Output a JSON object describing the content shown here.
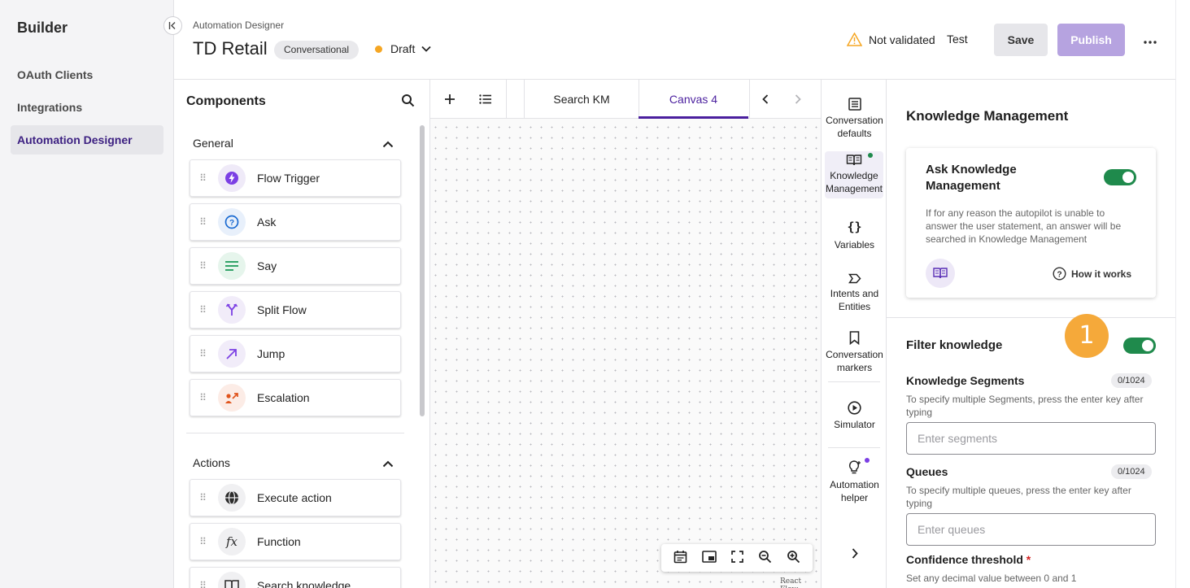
{
  "sidebar": {
    "brand": "Builder",
    "items": [
      {
        "label": "OAuth Clients"
      },
      {
        "label": "Integrations"
      },
      {
        "label": "Automation Designer"
      }
    ]
  },
  "header": {
    "breadcrumb": "Automation Designer",
    "title": "TD Retail",
    "tag": "Conversational",
    "status": "Draft",
    "validation": "Not validated",
    "test_label": "Test",
    "save_label": "Save",
    "publish_label": "Publish",
    "more_label": "•••"
  },
  "components": {
    "title": "Components",
    "sections": [
      {
        "label": "General",
        "items": [
          {
            "label": "Flow Trigger",
            "icon": "lightning-icon"
          },
          {
            "label": "Ask",
            "icon": "question-icon"
          },
          {
            "label": "Say",
            "icon": "lines-icon"
          },
          {
            "label": "Split Flow",
            "icon": "split-icon"
          },
          {
            "label": "Jump",
            "icon": "arrow-icon"
          },
          {
            "label": "Escalation",
            "icon": "escalation-icon"
          }
        ]
      },
      {
        "label": "Actions",
        "items": [
          {
            "label": "Execute action",
            "icon": "globe-icon"
          },
          {
            "label": "Function",
            "icon": "function-icon"
          },
          {
            "label": "Search knowledge",
            "icon": "book-icon"
          }
        ]
      }
    ]
  },
  "canvas": {
    "tabs": [
      {
        "label": "Search KM"
      },
      {
        "label": "Canvas 4"
      }
    ],
    "credit": "React Flow"
  },
  "iconbar": {
    "items": [
      {
        "label": "Conversation defaults"
      },
      {
        "label": "Knowledge Management"
      },
      {
        "label": "Variables",
        "glyph": "{}"
      },
      {
        "label": "Intents and Entities"
      },
      {
        "label": "Conversation markers"
      },
      {
        "label": "Simulator"
      },
      {
        "label": "Automation helper"
      }
    ]
  },
  "km": {
    "title": "Knowledge Management",
    "card": {
      "title": "Ask Knowledge Management",
      "enabled": true,
      "description": "If for any reason the autopilot is unable to answer the user statement, an answer will be searched in Knowledge Management",
      "how_label": "How it works"
    },
    "filter": {
      "title": "Filter knowledge",
      "enabled": true,
      "step_badge": "1"
    },
    "segments": {
      "label": "Knowledge Segments",
      "counter": "0/1024",
      "help": "To specify multiple Segments, press the enter key after typing",
      "placeholder": "Enter segments"
    },
    "queues": {
      "label": "Queues",
      "counter": "0/1024",
      "help": "To specify multiple queues, press the enter key after typing",
      "placeholder": "Enter queues"
    },
    "confidence": {
      "label": "Confidence threshold",
      "required": "*",
      "help": "Set any decimal value between 0 and 1"
    }
  },
  "colors": {
    "accent": "#4a1f9e",
    "publish": "#b6a3e0",
    "toggle_on": "#1f8a4c",
    "status_dot": "#f5a623",
    "badge": "#f5a93a"
  }
}
